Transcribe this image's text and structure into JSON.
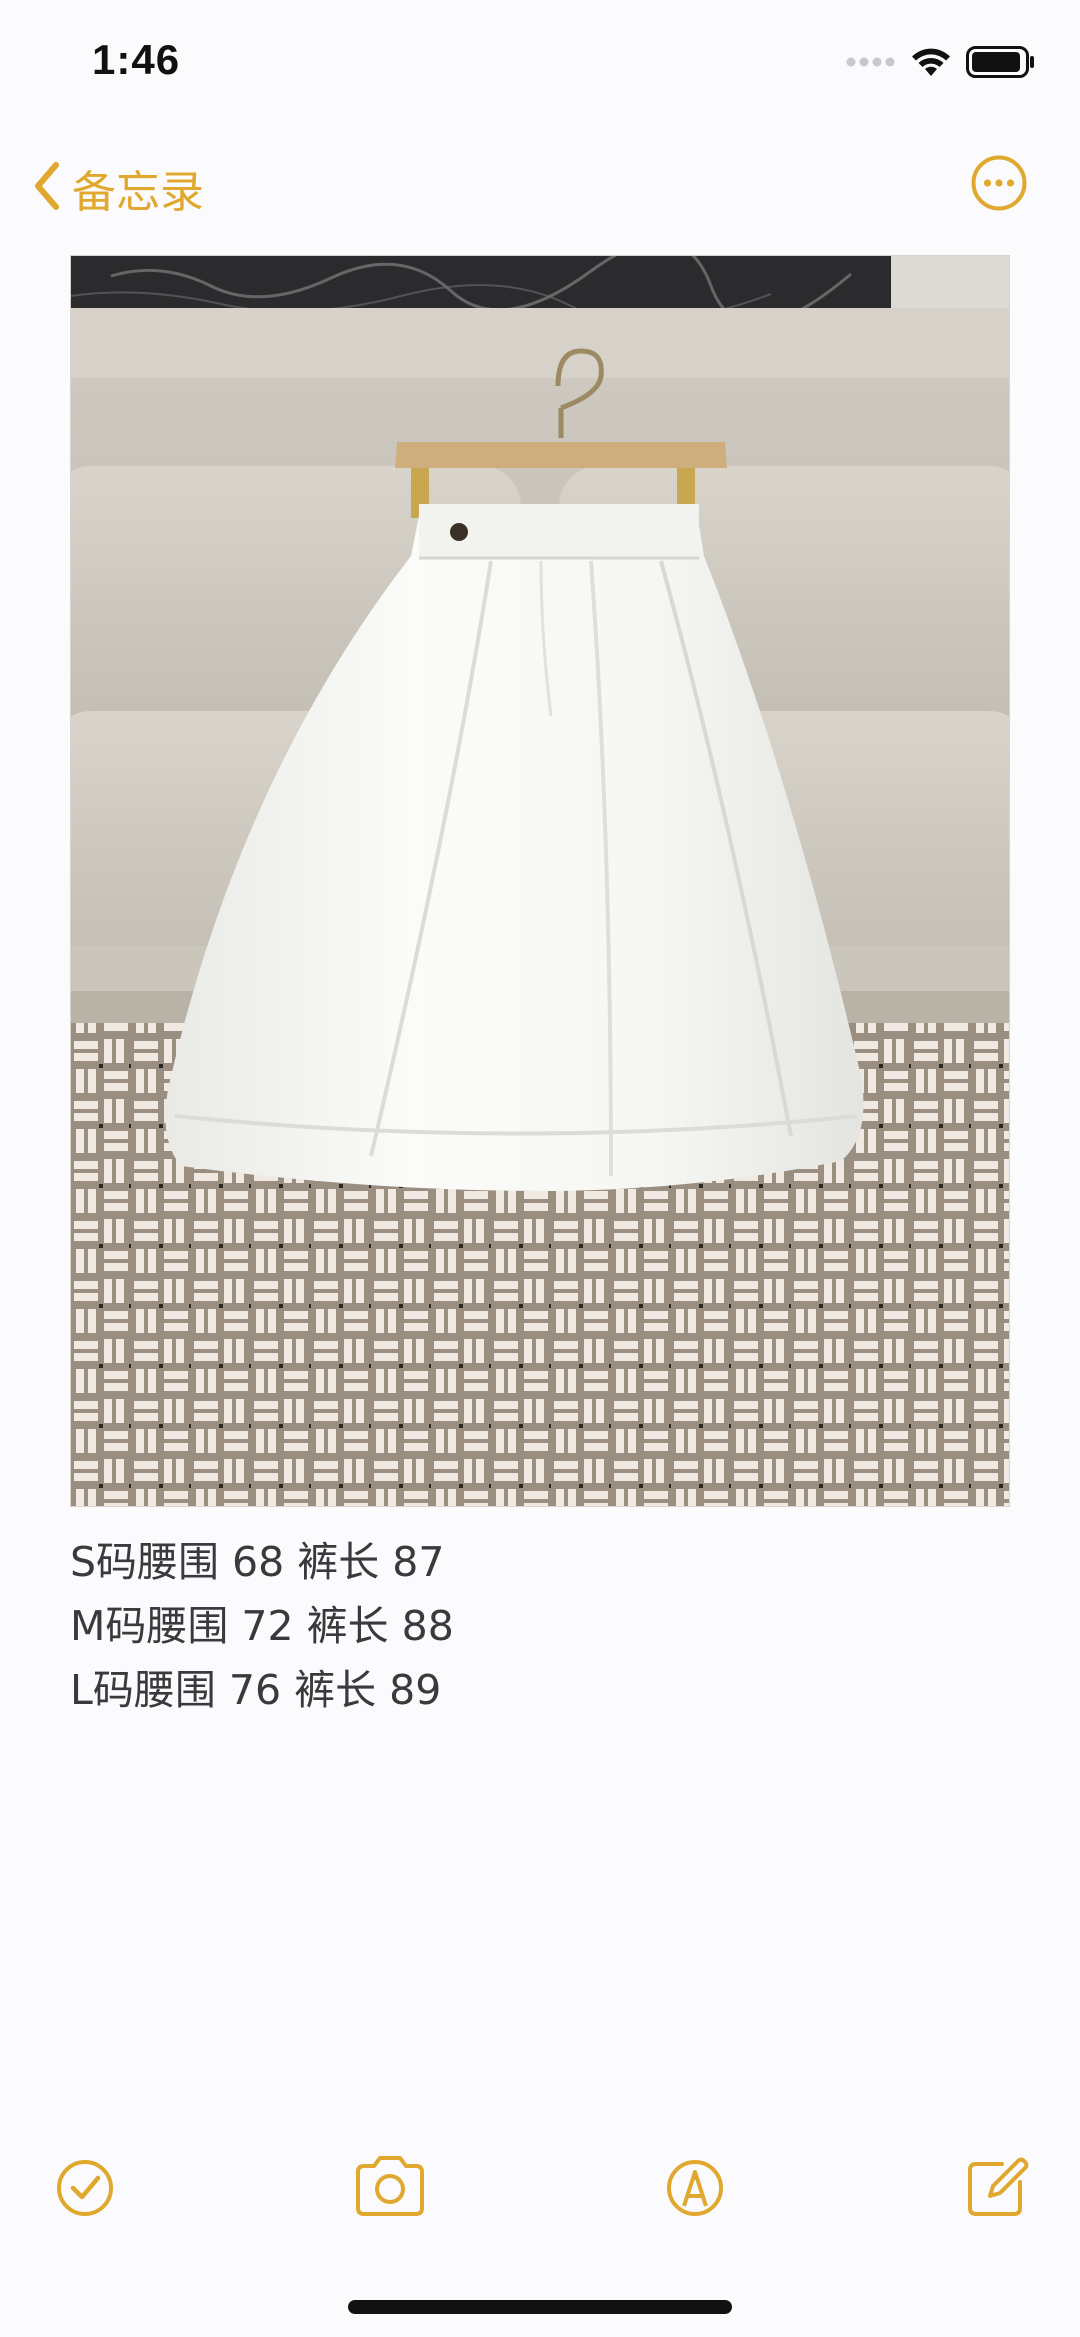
{
  "status_bar": {
    "time": "1:46",
    "icons": [
      "signal-dots-icon",
      "wifi-icon",
      "battery-icon"
    ]
  },
  "nav": {
    "back_label": "备忘录",
    "back_icon": "chevron-left-icon",
    "more_icon": "ellipsis-circle-icon"
  },
  "note": {
    "image": "photo of a white A-line midi skirt on a wooden hanger in front of a beige sofa",
    "lines": [
      "S码腰围 68 裤长 87",
      "M码腰围 72 裤长 88",
      "L码腰围 76 裤长 89"
    ]
  },
  "toolbar": {
    "icons": [
      "checklist-icon",
      "camera-icon",
      "markup-pen-icon",
      "compose-icon"
    ]
  },
  "colors": {
    "accent": "#e0a82e",
    "background": "#fbfbfd",
    "text": "#3a3a3c"
  }
}
